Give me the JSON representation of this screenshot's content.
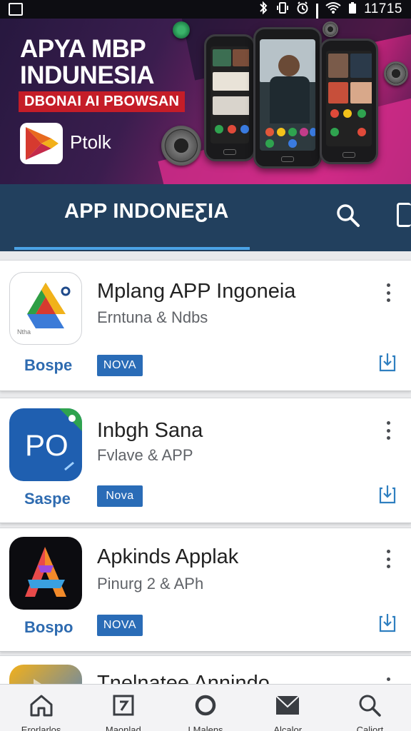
{
  "status_bar": {
    "time": "11715",
    "icons": [
      "gallery-icon",
      "bluetooth-icon",
      "vibrate-icon",
      "alarm-icon",
      "signal-icon",
      "wifi-icon",
      "battery-icon"
    ]
  },
  "banner": {
    "title_line1": "APYA MBP",
    "title_line2": "INDUNESIA",
    "ribbon": "DBONAI AI PBOWSAN",
    "logo_label": "Ptolk",
    "accent": "#c0237a",
    "ribbon_color": "#c51d28"
  },
  "appbar": {
    "title": "APP INDONEƸIA",
    "color": "#22405e",
    "indicator_color": "#4ba3e6",
    "icons": [
      "search-icon",
      "edit-icon"
    ]
  },
  "apps": [
    {
      "title": "Mplang APP Ingoneia",
      "subtitle": "Erntuna & Ndbs",
      "brand": "Bospe",
      "badge": "NOVA",
      "icon": "drive-style-icon"
    },
    {
      "title": "Inbgh Sana",
      "subtitle": "Fvlave & APP",
      "brand": "Saspe",
      "badge": "Nova",
      "icon": "po-icon"
    },
    {
      "title": "Apkinds Applak",
      "subtitle": "Pinurg 2 & APh",
      "brand": "Bospo",
      "badge": "NOVA",
      "icon": "a-logo-icon"
    },
    {
      "title": "Tnelnatee Annindo",
      "subtitle": "",
      "brand": "",
      "badge": "",
      "icon": "play-style-icon"
    }
  ],
  "bottom_nav": [
    {
      "label": "Erorlarlos",
      "icon": "home-icon"
    },
    {
      "label": "Maonlad",
      "icon": "updates-icon"
    },
    {
      "label": "I Malens",
      "icon": "circle-icon"
    },
    {
      "label": "Alcalor",
      "icon": "mail-icon"
    },
    {
      "label": "Caliort",
      "icon": "search-icon"
    }
  ]
}
